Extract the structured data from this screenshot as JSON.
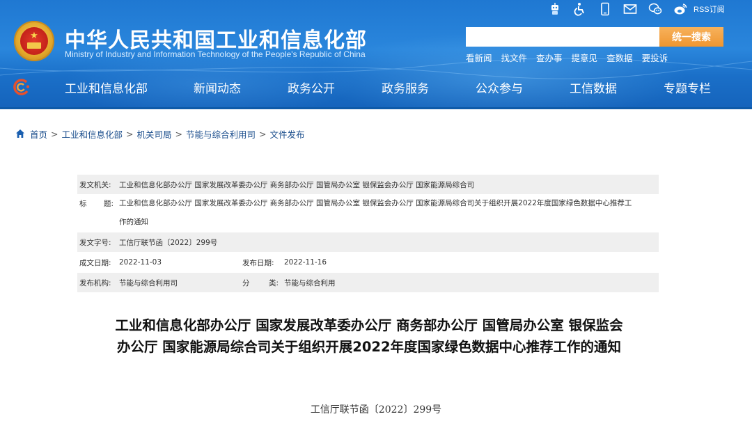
{
  "site": {
    "title": "中华人民共和国工业和信息化部",
    "subtitle": "Ministry of Industry and Information Technology of the People's Republic of China"
  },
  "top_icons": [
    "robot-icon",
    "accessibility-icon",
    "mobile-icon",
    "mail-icon",
    "wechat-icon",
    "weibo-icon"
  ],
  "rss_label": "RSS订阅",
  "search": {
    "placeholder": "",
    "button_label": "统一搜索"
  },
  "quick_links": [
    "看新闻",
    "找文件",
    "查办事",
    "提意见",
    "查数据",
    "要投诉"
  ],
  "nav": {
    "items": [
      "工业和信息化部",
      "新闻动态",
      "政务公开",
      "政务服务",
      "公众参与",
      "工信数据",
      "专题专栏"
    ]
  },
  "breadcrumb": [
    "首页",
    "工业和信息化部",
    "机关司局",
    "节能与综合利用司",
    "文件发布"
  ],
  "info": {
    "issuer_label": "发文机关:",
    "issuer": "工业和信息化部办公厅 国家发展改革委办公厅 商务部办公厅 国管局办公室 银保监会办公厅 国家能源局综合司",
    "title_label_1": "标",
    "title_label_2": "题:",
    "title_line1": "工业和信息化部办公厅 国家发展改革委办公厅 商务部办公厅 国管局办公室 银保监会办公厅 国家能源局综合司关于组织开展2022年度国家绿色数据中心推荐工",
    "title_line2": "作的通知",
    "doc_no_label": "发文字号:",
    "doc_no": "工信厅联节函〔2022〕299号",
    "created_label": "成文日期:",
    "created": "2022-11-03",
    "published_label": "发布日期:",
    "published": "2022-11-16",
    "org_label": "发布机构:",
    "org": "节能与综合利用司",
    "category_label_1": "分",
    "category_label_2": "类:",
    "category": "节能与综合利用"
  },
  "article": {
    "title_line1": "工业和信息化部办公厅 国家发展改革委办公厅 商务部办公厅 国管局办公室 银保监会",
    "title_line2": "办公厅 国家能源局综合司关于组织开展2022年度国家绿色数据中心推荐工作的通知",
    "doc_number": "工信厅联节函〔2022〕299号"
  },
  "colors": {
    "header_blue": "#1f78d2",
    "search_button": "#ef9630",
    "breadcrumb_text": "#1a4d8c",
    "table_shade": "#efefef"
  }
}
